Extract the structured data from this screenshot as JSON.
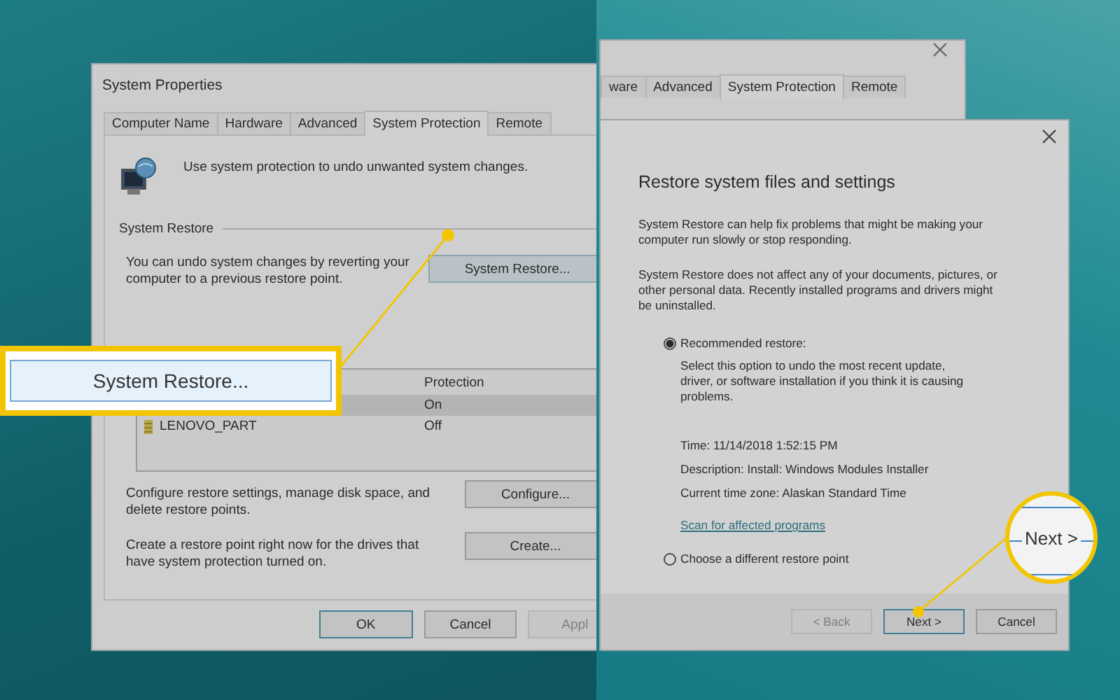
{
  "system_properties": {
    "title": "System Properties",
    "tabs": [
      {
        "label": "Computer Name",
        "selected": false
      },
      {
        "label": "Hardware",
        "selected": false
      },
      {
        "label": "Advanced",
        "selected": false
      },
      {
        "label": "System Protection",
        "selected": true
      },
      {
        "label": "Remote",
        "selected": false
      }
    ],
    "description": "Use system protection to undo unwanted system changes.",
    "system_restore": {
      "heading": "System Restore",
      "text": "You can undo system changes by reverting your computer to a previous restore point.",
      "button": "System Restore..."
    },
    "protection_table": {
      "columns": [
        "Protection"
      ],
      "rows": [
        {
          "protection": "On",
          "selected": true
        },
        {
          "drive": "LENOVO_PART",
          "protection": "Off",
          "selected": false
        }
      ]
    },
    "configure": {
      "text": "Configure restore settings, manage disk space, and delete restore points.",
      "button": "Configure..."
    },
    "create": {
      "text": "Create a restore point right now for the drives that have system protection turned on.",
      "button": "Create..."
    },
    "buttons": [
      {
        "label": "OK",
        "default": true,
        "disabled": false
      },
      {
        "label": "Cancel",
        "default": false,
        "disabled": false
      },
      {
        "label": "Appl",
        "default": false,
        "disabled": true
      }
    ]
  },
  "background_window": {
    "tabs": [
      {
        "label": "ware",
        "selected": false
      },
      {
        "label": "Advanced",
        "selected": false
      },
      {
        "label": "System Protection",
        "selected": true
      },
      {
        "label": "Remote",
        "selected": false
      }
    ]
  },
  "restore_dialog": {
    "title": "Restore system files and settings",
    "paragraphs": [
      "System Restore can help fix problems that might be making your computer run slowly or stop responding.",
      "System Restore does not affect any of your documents, pictures, or other personal data. Recently installed programs and drivers might be uninstalled."
    ],
    "options": [
      {
        "label": "Recommended restore:",
        "selected": true,
        "description": "Select this option to undo the most recent update, driver, or software installation if you think it is causing problems.",
        "info": [
          "Time: 11/14/2018 1:52:15 PM",
          "Description: Install: Windows Modules Installer",
          "Current time zone: Alaskan Standard Time"
        ],
        "link": "Scan for affected programs"
      },
      {
        "label": "Choose a different restore point",
        "selected": false
      }
    ],
    "buttons": [
      {
        "label": "< Back",
        "default": false,
        "disabled": true
      },
      {
        "label": "Next >",
        "default": true,
        "disabled": false
      },
      {
        "label": "Cancel",
        "default": false,
        "disabled": false
      }
    ]
  },
  "callouts": [
    {
      "kind": "box",
      "text": "System Restore..."
    },
    {
      "kind": "circle",
      "text": "Next >"
    }
  ]
}
